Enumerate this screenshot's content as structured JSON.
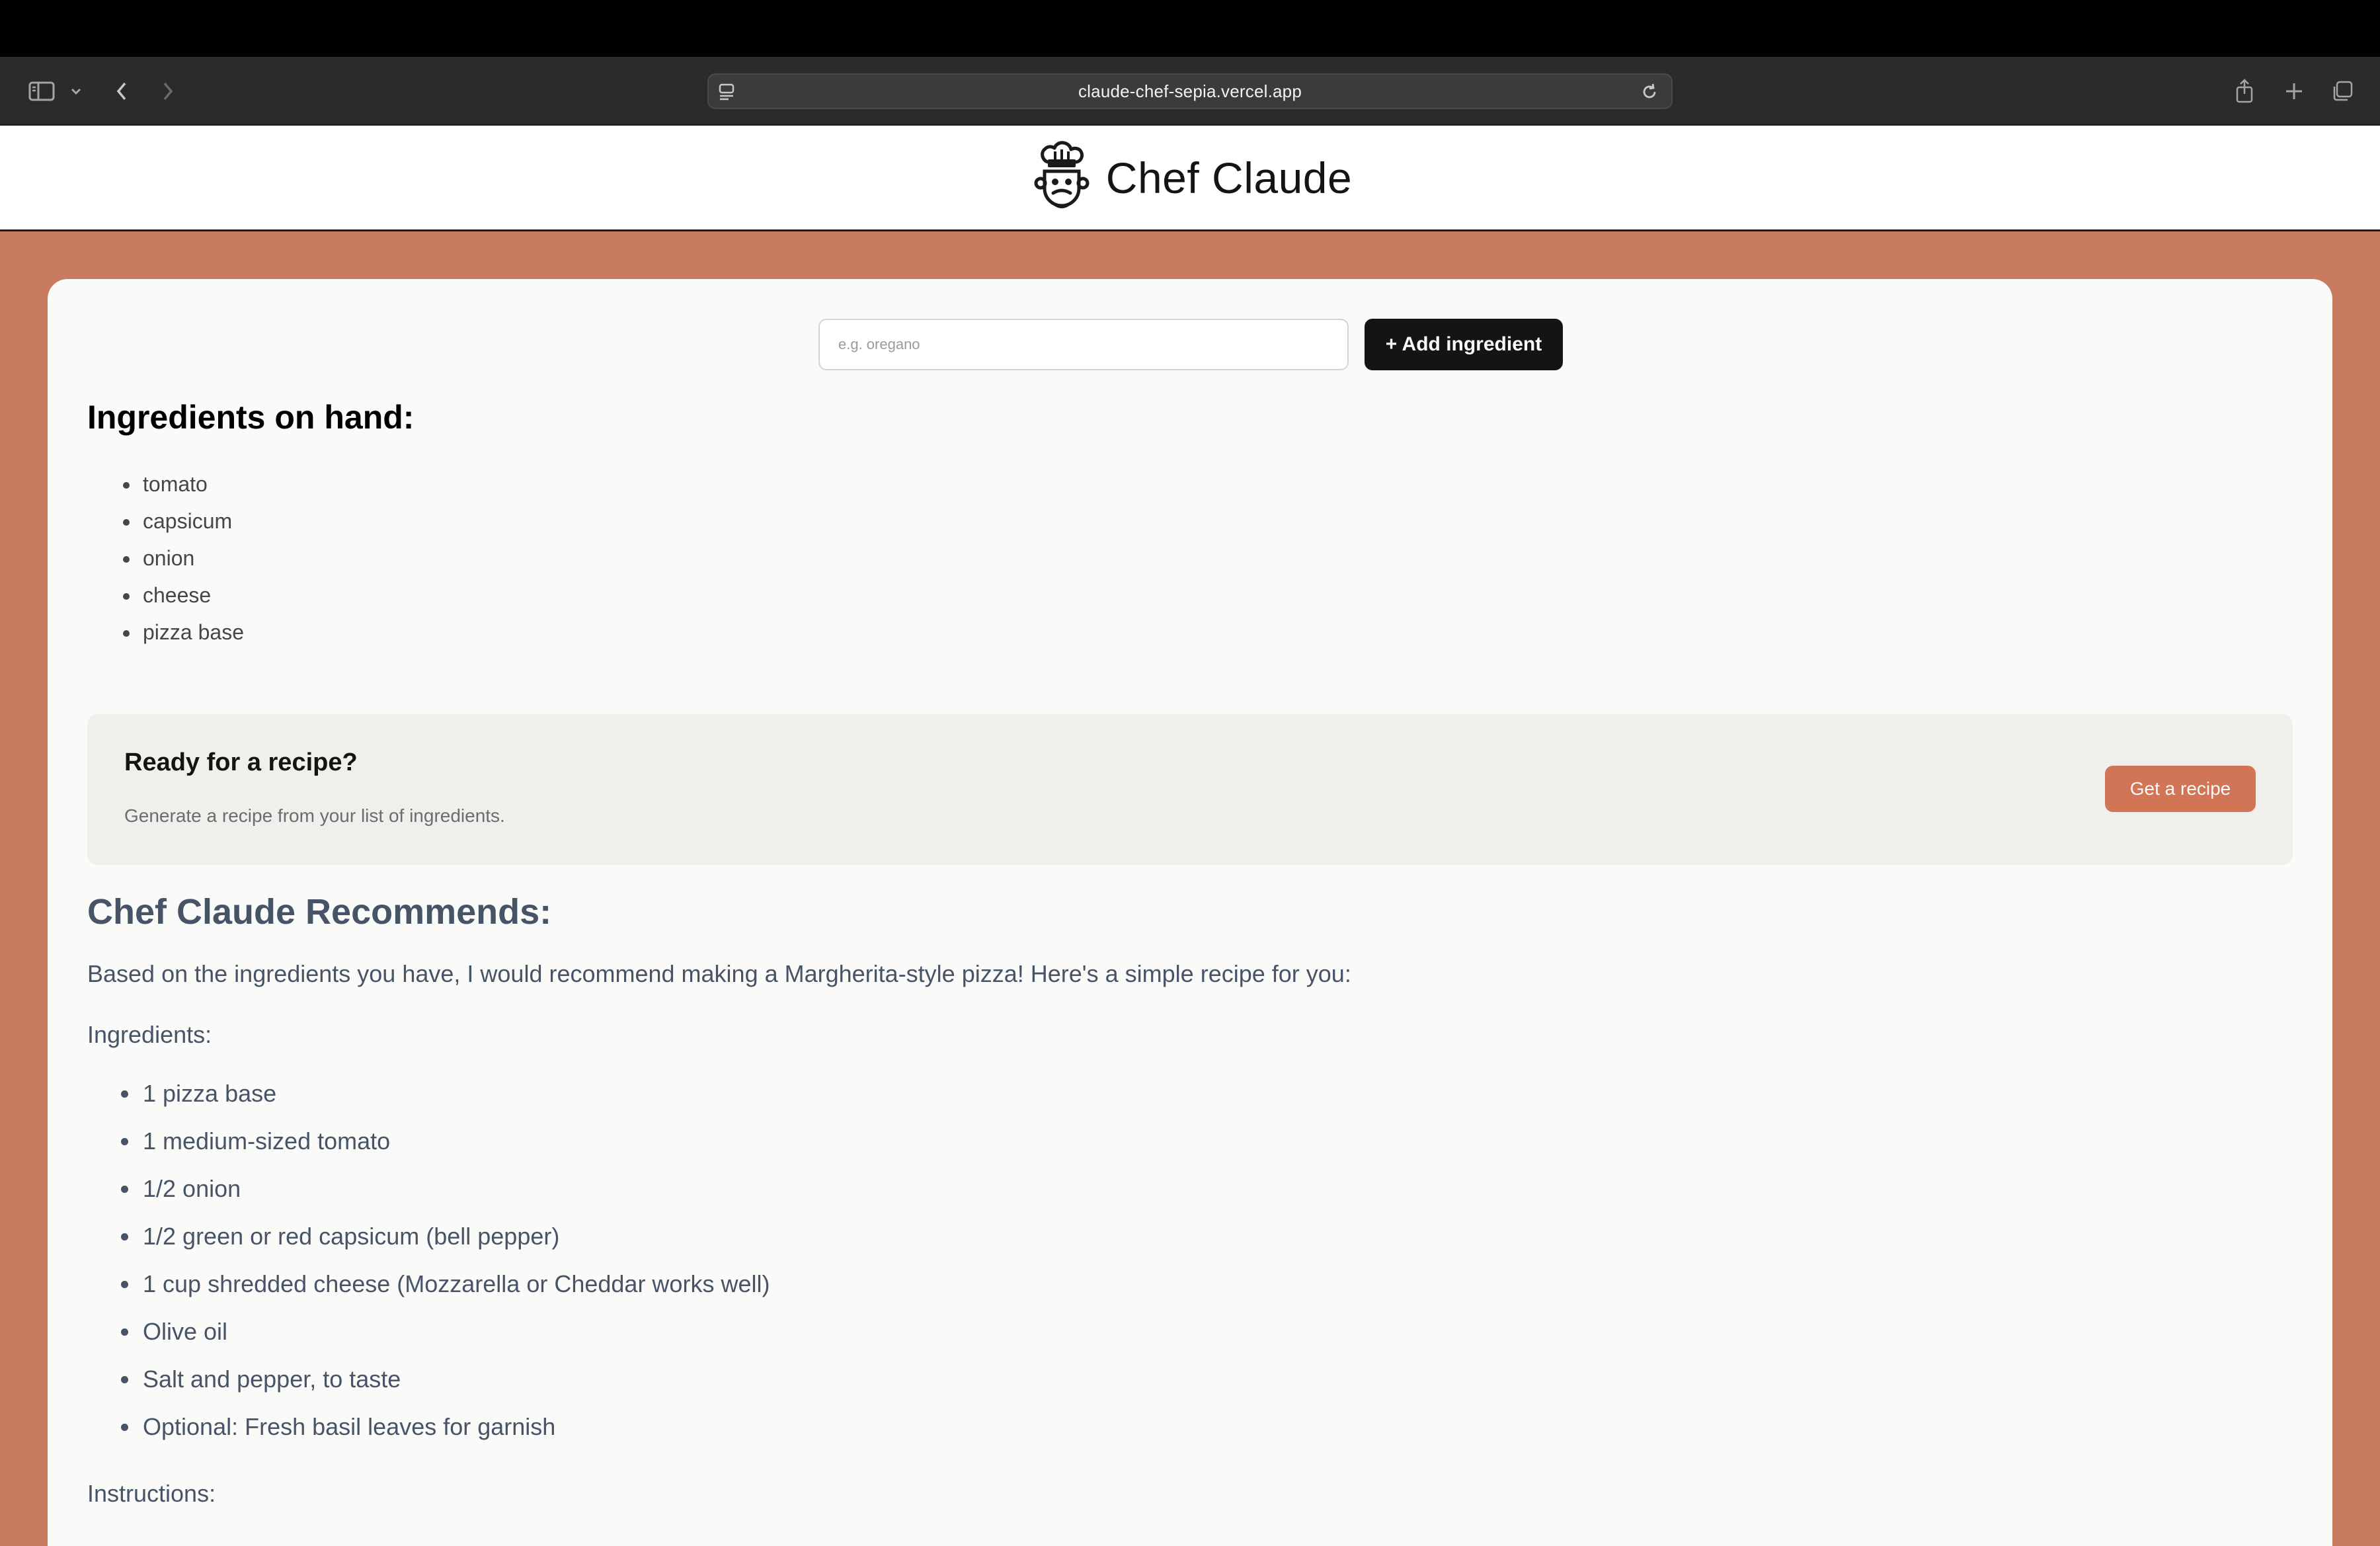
{
  "browser": {
    "url": "claude-chef-sepia.vercel.app",
    "icons": [
      "sidebar-icon",
      "chevron-down-icon",
      "back-arrow-icon",
      "forward-arrow-icon",
      "page-menu-icon",
      "reload-icon",
      "share-icon",
      "new-tab-icon",
      "tab-overview-icon"
    ]
  },
  "header": {
    "title": "Chef Claude",
    "logo_icon": "chef-hat-face-icon"
  },
  "form": {
    "placeholder": "e.g. oregano",
    "add_label": "+ Add ingredient"
  },
  "ingredients": {
    "heading": "Ingredients on hand:",
    "items": [
      "tomato",
      "capsicum",
      "onion",
      "cheese",
      "pizza base"
    ]
  },
  "cta": {
    "title": "Ready for a recipe?",
    "subtitle": "Generate a recipe from your list of ingredients.",
    "button_label": "Get a recipe"
  },
  "recipe": {
    "heading": "Chef Claude Recommends:",
    "intro": "Based on the ingredients you have, I would recommend making a Margherita-style pizza! Here's a simple recipe for you:",
    "ingredients_label": "Ingredients:",
    "ingredients": [
      "1 pizza base",
      "1 medium-sized tomato",
      "1/2 onion",
      "1/2 green or red capsicum (bell pepper)",
      "1 cup shredded cheese (Mozzarella or Cheddar works well)",
      "Olive oil",
      "Salt and pepper, to taste",
      "Optional: Fresh basil leaves for garnish"
    ],
    "instructions_label": "Instructions:"
  },
  "colors": {
    "page_background": "#c97b60",
    "card_background": "#fafaf8",
    "cta_button": "#d17557",
    "add_button": "#141413",
    "recipe_text": "#475467"
  }
}
